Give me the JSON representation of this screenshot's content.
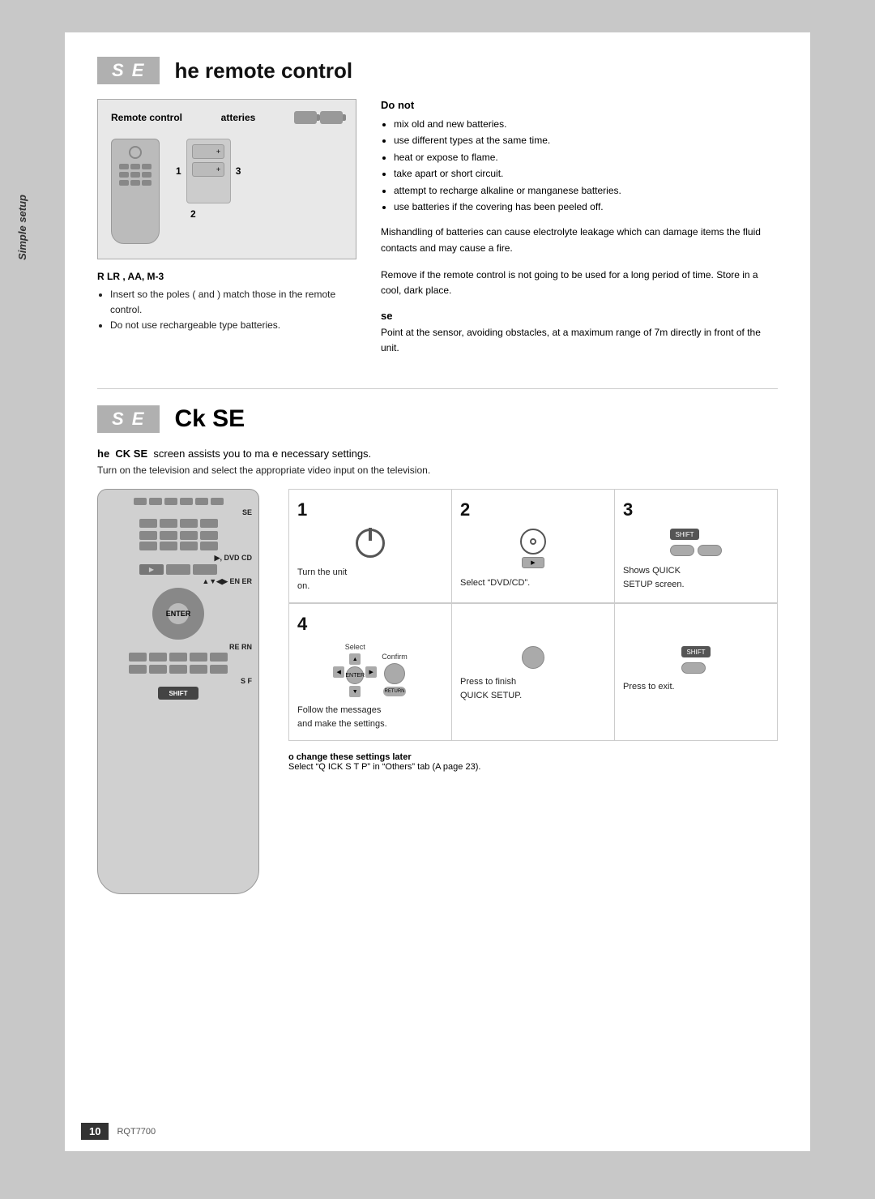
{
  "page": {
    "background_color": "#c8c8c8",
    "page_number": "10",
    "page_code": "RQT7700"
  },
  "side_label": "Simple setup",
  "section1": {
    "badge": "S E",
    "title": "he remote control",
    "left": {
      "battery_box": {
        "remote_label": "Remote control",
        "batteries_label": "atteries"
      },
      "step_r": "R  LR , AA, M-3",
      "steps": [
        "Insert so the poles (  and ) match those in the remote control.",
        "Do not use rechargeable type batteries."
      ],
      "numbers": [
        "1",
        "3",
        "2"
      ]
    },
    "right": {
      "do_not_title": "Do not",
      "do_not_items": [
        "mix old and new batteries.",
        "use different types at the same time.",
        "heat or expose to flame.",
        "take apart or short circuit.",
        "attempt to recharge alkaline or manganese batteries.",
        "use batteries if the covering has been peeled off."
      ],
      "mishandling_text": "Mishandling of batteries can cause electrolyte leakage which can damage items the fluid contacts and may cause a fire.",
      "remove_text": "Remove if the remote control is not going to be used for a long period of time. Store in a cool, dark place.",
      "sensor_title": "se",
      "sensor_text": "Point at the sensor, avoiding obstacles, at a maximum range of 7m  directly in front of the unit."
    }
  },
  "section2": {
    "badge": "S E",
    "title": "Ck SE",
    "subtitle_pre": "he",
    "subtitle_ck": "CK SE",
    "subtitle_post": "screen assists you to ma e necessary settings.",
    "desc": "Turn on the television and select the appropriate video input on the television.",
    "left_labels": {
      "se_label": "SE",
      "dvd_cd_label": "▶, DVD CD",
      "enter_label": "▲▼◀▶ EN ER",
      "return_label": "RE  RN",
      "shift_label": "S F"
    },
    "steps": [
      {
        "number": "1",
        "icon_type": "power",
        "desc_line1": "Turn the unit",
        "desc_line2": "on."
      },
      {
        "number": "2",
        "icon_type": "dvd",
        "desc_line1": "Select “DVD/CD”."
      },
      {
        "number": "3",
        "icon_type": "shift_setup",
        "desc_line1": "Shows QUICK",
        "desc_line2": "SETUP screen."
      }
    ],
    "step4": {
      "number": "4",
      "icon_type": "arrows_enter",
      "select_label": "Select",
      "confirm_label": "Confirm",
      "desc_line1": "Follow the messages",
      "desc_line2": "and make the settings.",
      "cell2_line1": "Press to finish",
      "cell2_line2": "QUICK SETUP.",
      "cell3_line1": "Press to exit."
    },
    "footer": {
      "title": "o change these settings later",
      "text": "Select “Q  ICK S T  P” in “Others” tab (A  page 23)."
    }
  }
}
